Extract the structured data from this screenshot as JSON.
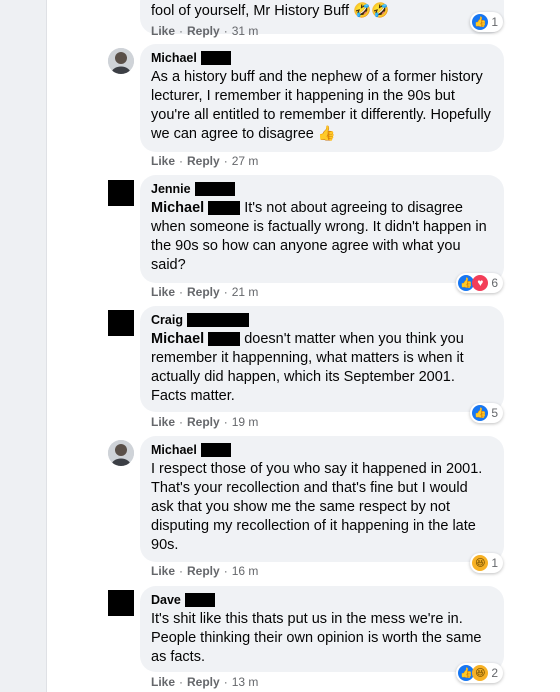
{
  "comments": [
    {
      "text_end": "fool of yourself, Mr History Buff 🤣🤣",
      "actions": {
        "like": "Like",
        "reply": "Reply",
        "time": "31 m"
      },
      "reactions": {
        "count": "1"
      }
    },
    {
      "author": "Michael",
      "text": "As a history buff and the nephew of a former history lecturer, I remember it happening in the 90s but you're all entitled to remember it differently. Hopefully we can agree to disagree 👍",
      "actions": {
        "like": "Like",
        "reply": "Reply",
        "time": "27 m"
      }
    },
    {
      "author": "Jennie",
      "mention": "Michael",
      "text": "It's not about agreeing to disagree when someone is factually wrong. It didn't happen in the 90s so how can anyone agree with what you said?",
      "actions": {
        "like": "Like",
        "reply": "Reply",
        "time": "21 m"
      },
      "reactions": {
        "count": "6"
      }
    },
    {
      "author": "Craig",
      "mention": "Michael",
      "text": "doesn't matter when you think you remember it happenning, what matters is when it actually did happen, which its September 2001. Facts matter.",
      "actions": {
        "like": "Like",
        "reply": "Reply",
        "time": "19 m"
      },
      "reactions": {
        "count": "5"
      }
    },
    {
      "author": "Michael",
      "text": "I respect those of you who say it happened in 2001. That's your recollection and that's fine but I would ask that you show me the same respect by not disputing my recollection of it happening in the late 90s.",
      "actions": {
        "like": "Like",
        "reply": "Reply",
        "time": "16 m"
      },
      "reactions": {
        "count": "1"
      }
    },
    {
      "author": "Dave",
      "text": "It's shit like this thats put us in the mess we're in. People thinking their own opinion is worth the same as facts.",
      "actions": {
        "like": "Like",
        "reply": "Reply",
        "time": "13 m"
      },
      "reactions": {
        "count": "2"
      }
    }
  ],
  "colors": {
    "like": "#1877f2",
    "love": "#f33e58",
    "haha": "#f7b125",
    "bubble": "#f0f2f5",
    "meta": "#65676b"
  },
  "icons": [
    "like-icon",
    "love-icon",
    "haha-icon",
    "avatar-photo"
  ]
}
